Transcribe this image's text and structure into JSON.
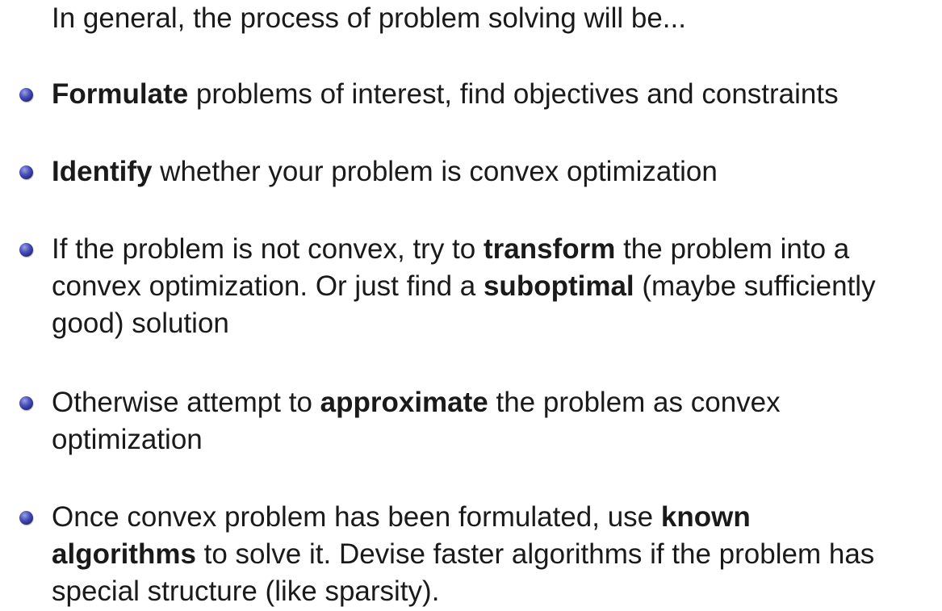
{
  "intro": "In general, the process of problem solving will be...",
  "bullets": [
    {
      "lines": [
        [
          {
            "text": "Formulate",
            "bold": true
          },
          {
            "text": " problems of interest, find objectives and constraints",
            "bold": false
          }
        ]
      ]
    },
    {
      "lines": [
        [
          {
            "text": "Identify",
            "bold": true
          },
          {
            "text": " whether your problem is convex optimization",
            "bold": false
          }
        ]
      ]
    },
    {
      "lines": [
        [
          {
            "text": "If the problem is not convex, try to ",
            "bold": false
          },
          {
            "text": "transform",
            "bold": true
          },
          {
            "text": " the problem into a",
            "bold": false
          }
        ],
        [
          {
            "text": "convex optimization. Or just find a ",
            "bold": false
          },
          {
            "text": "suboptimal",
            "bold": true
          },
          {
            "text": " (maybe sufficiently",
            "bold": false
          }
        ],
        [
          {
            "text": "good) solution",
            "bold": false
          }
        ]
      ]
    },
    {
      "lines": [
        [
          {
            "text": "Otherwise attempt to ",
            "bold": false
          },
          {
            "text": "approximate",
            "bold": true
          },
          {
            "text": " the problem as convex",
            "bold": false
          }
        ],
        [
          {
            "text": "optimization",
            "bold": false
          }
        ]
      ]
    },
    {
      "lines": [
        [
          {
            "text": "Once convex problem has been formulated, use ",
            "bold": false
          },
          {
            "text": "known",
            "bold": true
          }
        ],
        [
          {
            "text": "algorithms",
            "bold": true
          },
          {
            "text": " to solve it. Devise faster algorithms if the problem has",
            "bold": false
          }
        ],
        [
          {
            "text": "special structure (like sparsity).",
            "bold": false
          }
        ]
      ]
    }
  ]
}
